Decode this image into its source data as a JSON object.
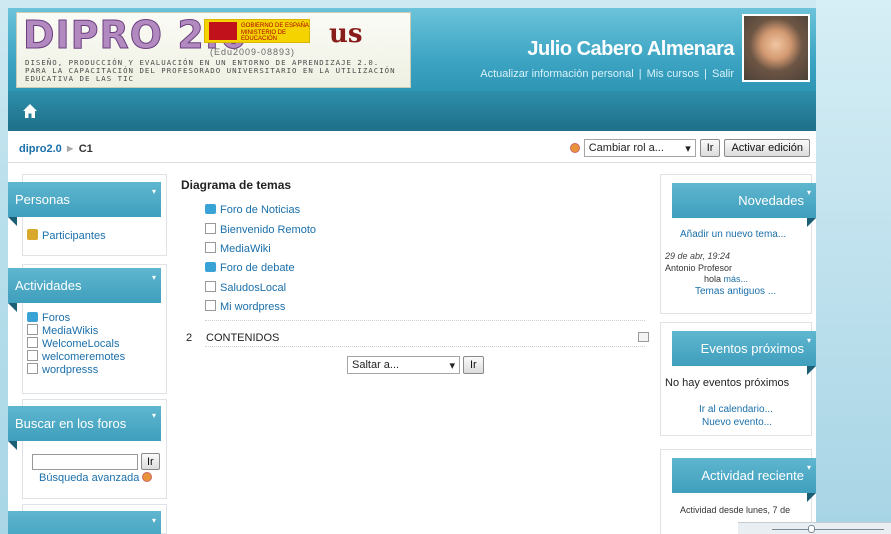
{
  "header": {
    "logo_title": "DIPRO 2.0",
    "logo_code": "(Edu2009-08893)",
    "logo_subtitle": "DISEÑO, PRODUCCIÓN Y EVALUACIÓN EN UN ENTORNO DE APRENDIZAJE 2.0. PARA LA CAPACITACIÓN DEL PROFESORADO UNIVERSITARIO EN LA UTILIZACIÓN EDUCATIVA DE LAS TIC",
    "gov_text": "GOBIERNO DE ESPAÑA MINISTERIO DE EDUCACIÓN",
    "uni_logo": "us",
    "user_name": "Julio Cabero Almenara",
    "link_update": "Actualizar información personal",
    "link_courses": "Mis cursos",
    "link_exit": "Salir",
    "separator": "|"
  },
  "breadcrumb": {
    "root": "dipro2.0",
    "arrow": "►",
    "current": "C1"
  },
  "role": {
    "select_value": "Cambiar rol a...",
    "go": "Ir",
    "edit": "Activar edición"
  },
  "left": {
    "personas_title": "Personas",
    "participantes": "Participantes",
    "actividades_title": "Actividades",
    "activities": [
      "Foros",
      "MediaWikis",
      "WelcomeLocals",
      "welcomeremotes",
      "wordpresss"
    ],
    "buscar_title": "Buscar en los foros",
    "search_value": "",
    "search_go": "Ir",
    "advanced": "Búsqueda avanzada"
  },
  "main": {
    "title": "Diagrama de temas",
    "topics": [
      {
        "label": "Foro de Noticias",
        "icon": "forum"
      },
      {
        "label": "Bienvenido Remoto",
        "icon": "page"
      },
      {
        "label": "MediaWiki",
        "icon": "page"
      },
      {
        "label": "Foro de debate",
        "icon": "forum"
      },
      {
        "label": "SaludosLocal",
        "icon": "page"
      },
      {
        "label": "Mi wordpress",
        "icon": "page"
      }
    ],
    "section_number": "2",
    "section_title": "CONTENIDOS",
    "jump_value": "Saltar a...",
    "jump_go": "Ir"
  },
  "right": {
    "novedades_title": "Novedades",
    "add_topic": "Añadir un nuevo tema...",
    "post_date": "29 de abr, 19:24",
    "post_author": "Antonio Profesor",
    "post_text": "hola",
    "post_more": "más...",
    "older": "Temas antiguos ...",
    "eventos_title": "Eventos próximos",
    "no_events": "No hay eventos próximos",
    "calendar": "Ir al calendario...",
    "new_event": "Nuevo evento...",
    "reciente_title": "Actividad reciente",
    "activity_since": "Actividad desde lunes, 7 de"
  },
  "colors": {
    "accent": "#3f9fbd",
    "link": "#1a6faa",
    "header_bg": "#3ea6c4"
  }
}
